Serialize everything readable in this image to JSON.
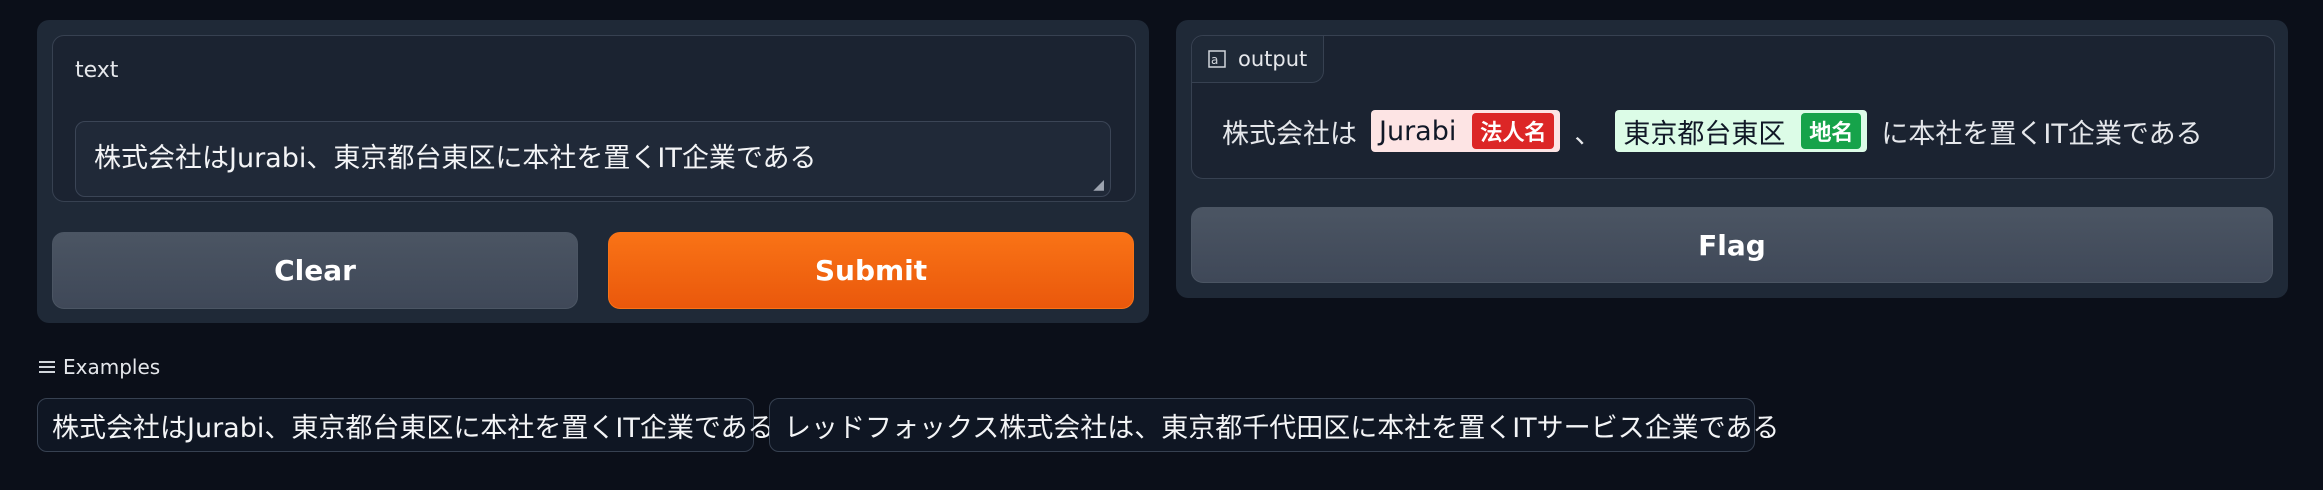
{
  "input": {
    "label": "text",
    "value": "株式会社はJurabi、東京都台東区に本社を置くIT企業である"
  },
  "buttons": {
    "clear": "Clear",
    "submit": "Submit",
    "flag": "Flag"
  },
  "output": {
    "label": "output",
    "icon": "highlight-icon",
    "segments": {
      "text1": "株式会社は",
      "entity1": {
        "text": "Jurabi",
        "label": "法人名",
        "color": "#dc2626",
        "bg": "#fde4e4"
      },
      "text2": "、",
      "entity2": {
        "text": "東京都台東区",
        "label": "地名",
        "color": "#16a34a",
        "bg": "#dcfce7"
      },
      "text3": "に本社を置くIT企業である"
    }
  },
  "examples": {
    "label": "Examples",
    "items": [
      "株式会社はJurabi、東京都台東区に本社を置くIT企業である",
      "レッドフォックス株式会社は、東京都千代田区に本社を置くITサービス企業である"
    ]
  },
  "colors": {
    "accent": "#f97316",
    "background": "#0b0f19",
    "panel": "#1f2937"
  }
}
